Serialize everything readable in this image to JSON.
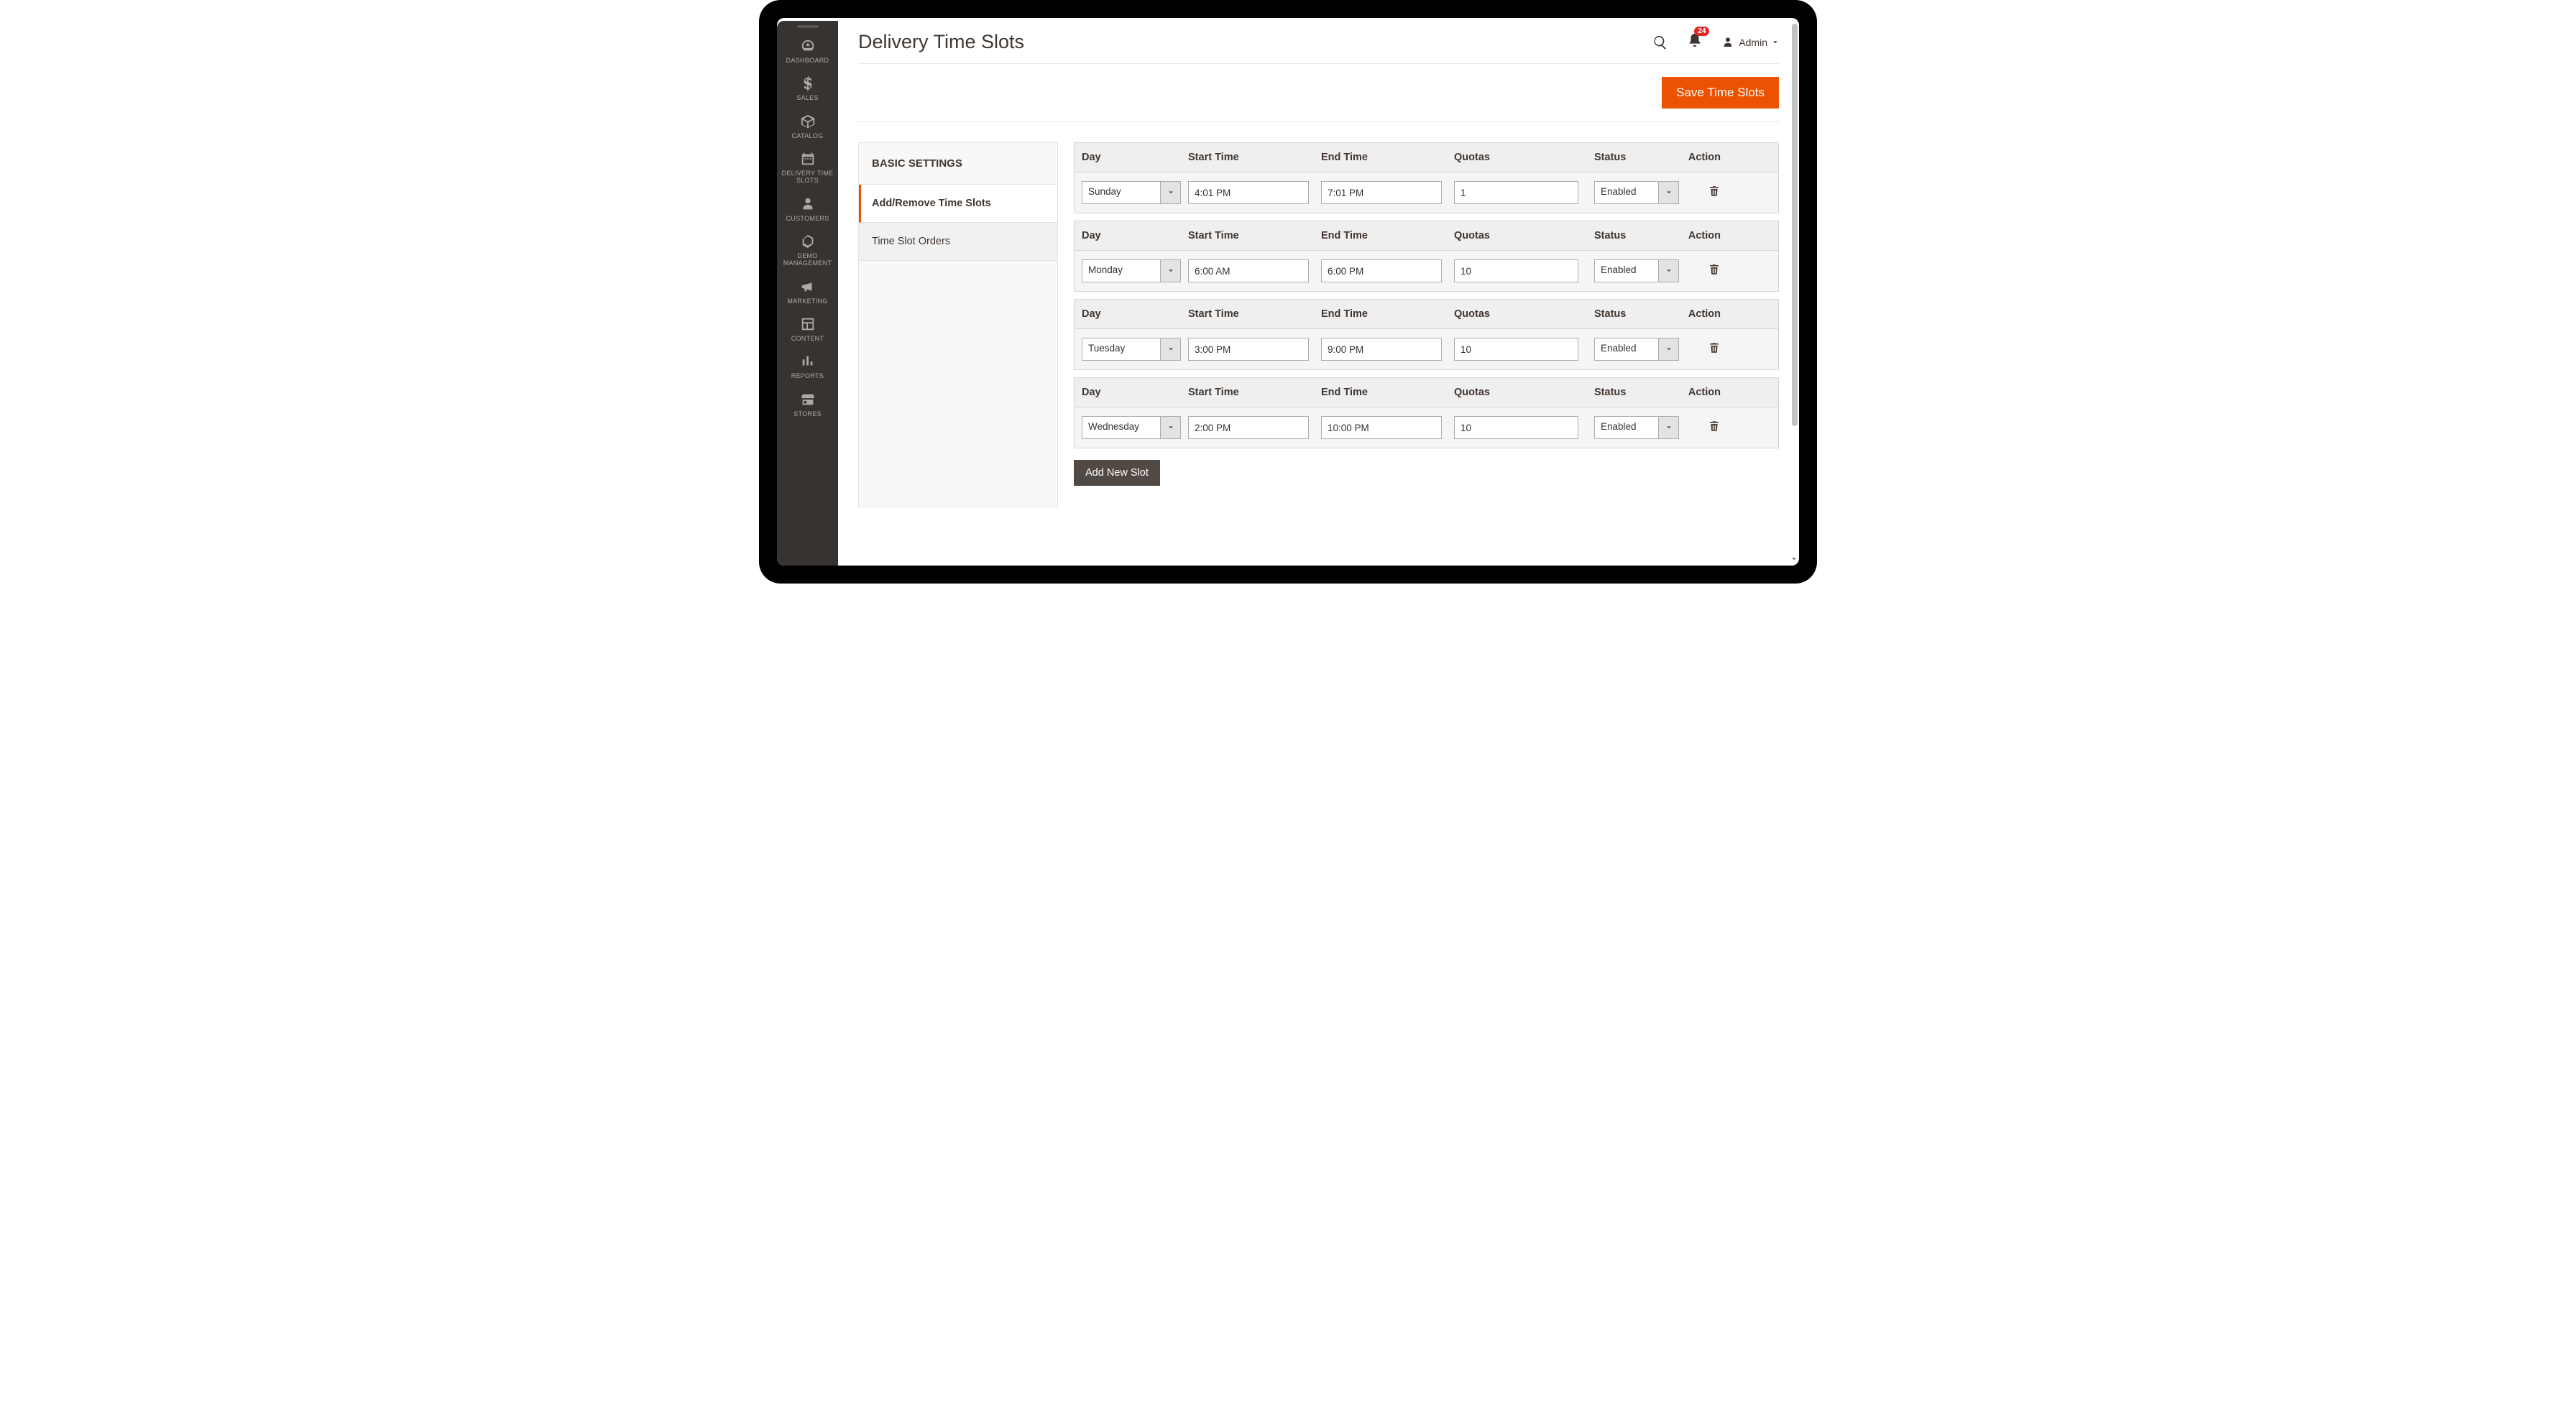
{
  "pageTitle": "Delivery Time Slots",
  "header": {
    "notifCount": "24",
    "userName": "Admin"
  },
  "toolbar": {
    "saveLabel": "Save Time Slots"
  },
  "sidebar": {
    "items": [
      {
        "label": "DASHBOARD"
      },
      {
        "label": "SALES"
      },
      {
        "label": "CATALOG"
      },
      {
        "label": "DELIVERY TIME SLOTS"
      },
      {
        "label": "CUSTOMERS"
      },
      {
        "label": "DEMO MANAGEMENT"
      },
      {
        "label": "MARKETING"
      },
      {
        "label": "CONTENT"
      },
      {
        "label": "REPORTS"
      },
      {
        "label": "STORES"
      }
    ]
  },
  "settings": {
    "title": "BASIC SETTINGS",
    "items": [
      {
        "label": "Add/Remove Time Slots",
        "active": true
      },
      {
        "label": "Time Slot Orders",
        "active": false
      }
    ]
  },
  "columns": {
    "day": "Day",
    "start": "Start Time",
    "end": "End Time",
    "quotas": "Quotas",
    "status": "Status",
    "action": "Action"
  },
  "slots": [
    {
      "day": "Sunday",
      "start": "4:01 PM",
      "end": "7:01 PM",
      "quotas": "1",
      "status": "Enabled"
    },
    {
      "day": "Monday",
      "start": "6:00 AM",
      "end": "6:00 PM",
      "quotas": "10",
      "status": "Enabled"
    },
    {
      "day": "Tuesday",
      "start": "3:00 PM",
      "end": "9:00 PM",
      "quotas": "10",
      "status": "Enabled"
    },
    {
      "day": "Wednesday",
      "start": "2:00 PM",
      "end": "10:00 PM",
      "quotas": "10",
      "status": "Enabled"
    }
  ],
  "addSlotLabel": "Add New Slot"
}
